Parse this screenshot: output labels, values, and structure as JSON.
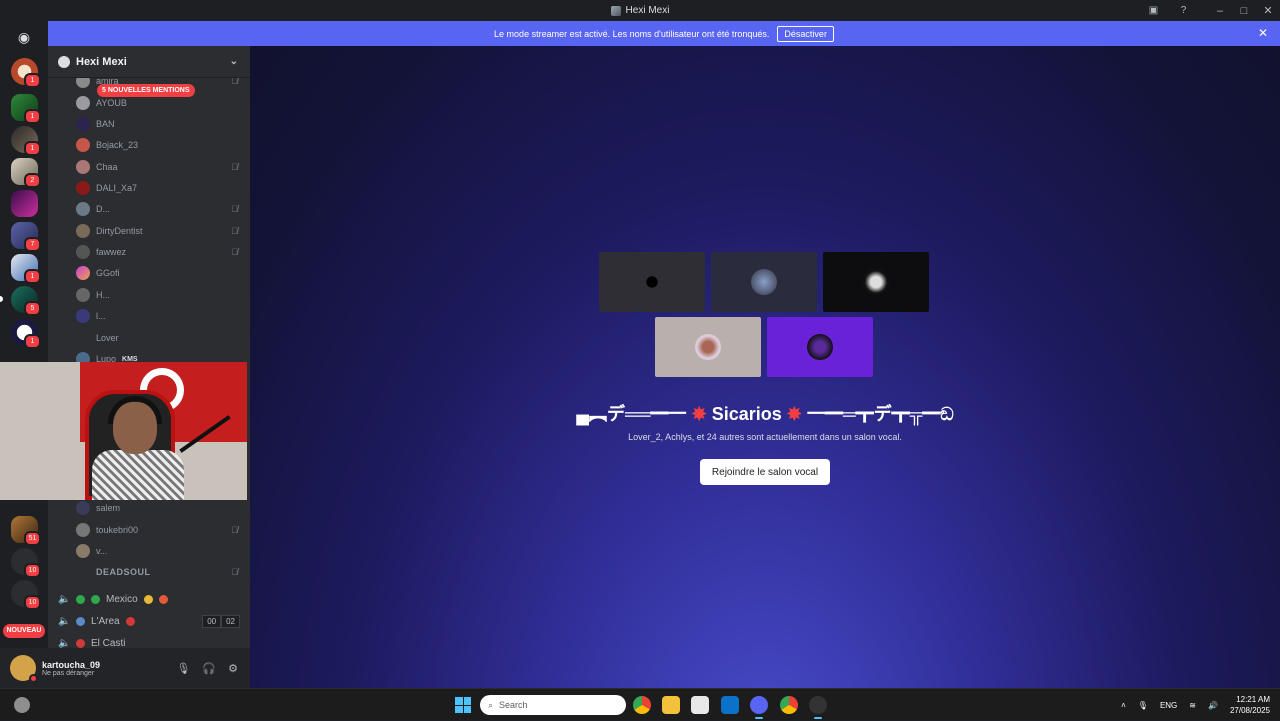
{
  "window": {
    "title": "Hexi Mexi"
  },
  "banner": {
    "text": "Le mode streamer est activé. Les noms d'utilisateur ont été tronqués.",
    "action_label": "Désactiver"
  },
  "server_rail": {
    "nouveau_label": "NOUVEAU",
    "badges": [
      "1",
      "1",
      "1",
      "2",
      "7",
      "1",
      "5",
      "1",
      "51",
      "10",
      "10"
    ]
  },
  "sidebar": {
    "guild_name": "Hexi Mexi",
    "mentions_pill": "5 NOUVELLES MENTIONS",
    "members_top": [
      "amira",
      "AYOUB",
      "BAN",
      "Bojack_23",
      "Chaa",
      "DALI_Xa7",
      "D...",
      "DirtyDentist",
      "fawwez",
      "GGofi",
      "H...",
      "l...",
      "Lover",
      "Lupo"
    ],
    "lupo_tag": "KMS",
    "members_bottom": [
      "salem",
      "toukebri00",
      "v...",
      "DEADSOUL"
    ],
    "voice_channels": [
      {
        "name": "Mexico"
      },
      {
        "name": "L'Area",
        "counts": [
          "00",
          "02"
        ]
      },
      {
        "name": "El Casti"
      }
    ]
  },
  "stage": {
    "title_left": "▄︻デ══━一",
    "title_name": "Sicarios",
    "title_right": "一━═┳デ┳╦━ඞ",
    "subtitle": "Lover_2, Achlys, et 24 autres sont actuellement dans un salon vocal.",
    "join_label": "Rejoindre le salon vocal"
  },
  "user_panel": {
    "username": "kartoucha_09",
    "status": "Ne pas déranger"
  },
  "taskbar": {
    "search_placeholder": "Search",
    "lang": "ENG",
    "time": "12:21 AM",
    "date": "27/08/2025"
  },
  "colors": {
    "blurple": "#5865f2",
    "danger": "#f23f43",
    "sidebar": "#2b2d31",
    "rail": "#1e1f22"
  }
}
